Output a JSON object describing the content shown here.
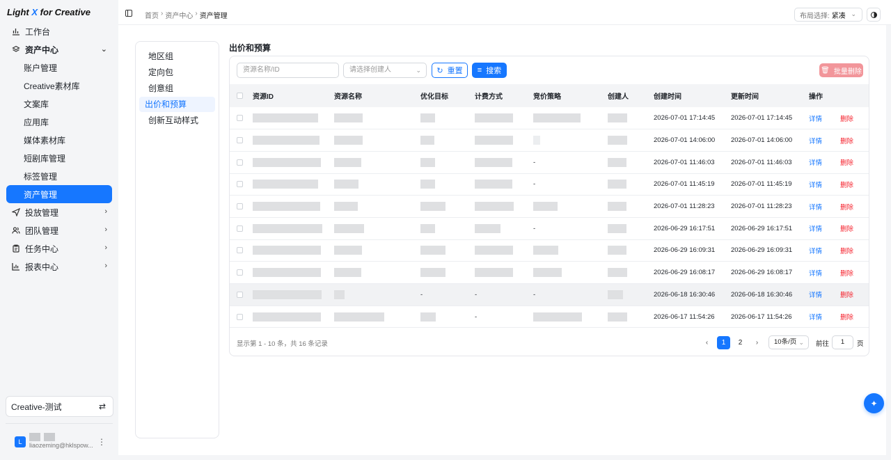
{
  "app": {
    "brand_prefix": "Light ",
    "brand_x": "X",
    "brand_suffix": " for Creative"
  },
  "sidebar": {
    "items": [
      {
        "label": "工作台",
        "icon": "bar-chart-icon"
      },
      {
        "label": "资产中心",
        "icon": "layers-icon",
        "expanded": true,
        "children": [
          "账户管理",
          "Creative素材库",
          "文案库",
          "应用库",
          "媒体素材库",
          "短剧库管理",
          "标签管理",
          "资产管理"
        ]
      },
      {
        "label": "投放管理",
        "icon": "send-icon"
      },
      {
        "label": "团队管理",
        "icon": "team-icon"
      },
      {
        "label": "任务中心",
        "icon": "clipboard-icon"
      },
      {
        "label": "报表中心",
        "icon": "report-icon"
      }
    ],
    "active_child": "资产管理",
    "tenant": "Creative-测试",
    "user": {
      "avatar": "L",
      "email": "liaozeming@hklspow..."
    }
  },
  "topbar": {
    "breadcrumb": [
      "首页",
      "资产中心",
      "资产管理"
    ],
    "layout_label": "布局选择:",
    "layout_value": "紧凑"
  },
  "asset_menu": {
    "items": [
      "地区组",
      "定向包",
      "创意组",
      "出价和预算",
      "创新互动样式"
    ],
    "active": "出价和预算"
  },
  "section_title": "出价和预算",
  "filters": {
    "id_placeholder": "资源名称/ID",
    "creator_placeholder": "请选择创建人",
    "reset": "重置",
    "search": "搜索",
    "batch_delete": "批量删除"
  },
  "table": {
    "columns": [
      "资源ID",
      "资源名称",
      "优化目标",
      "计费方式",
      "竞价策略",
      "创建人",
      "创建时间",
      "更新时间",
      "操作"
    ],
    "action_detail": "详情",
    "action_delete": "删除",
    "rows": [
      {
        "created": "2026-07-01 17:14:45",
        "updated": "2026-07-01 17:14:45",
        "bid": ""
      },
      {
        "created": "2026-07-01 14:06:00",
        "updated": "2026-07-01 14:06:00",
        "bid": ""
      },
      {
        "created": "2026-07-01 11:46:03",
        "updated": "2026-07-01 11:46:03",
        "bid": "-"
      },
      {
        "created": "2026-07-01 11:45:19",
        "updated": "2026-07-01 11:45:19",
        "bid": "-"
      },
      {
        "created": "2026-07-01 11:28:23",
        "updated": "2026-07-01 11:28:23",
        "bid": ""
      },
      {
        "created": "2026-06-29 16:17:51",
        "updated": "2026-06-29 16:17:51",
        "bid": "-"
      },
      {
        "created": "2026-06-29 16:09:31",
        "updated": "2026-06-29 16:09:31",
        "bid": ""
      },
      {
        "created": "2026-06-29 16:08:17",
        "updated": "2026-06-29 16:08:17",
        "bid": ""
      },
      {
        "created": "2026-06-18 16:30:46",
        "updated": "2026-06-18 16:30:46",
        "opt": "-",
        "billing": "-",
        "bid": "-"
      },
      {
        "created": "2026-06-17 11:54:26",
        "updated": "2026-06-17 11:54:26",
        "billing": "-",
        "bid": ""
      }
    ]
  },
  "footer": {
    "summary": "显示第 1 - 10 条，共 16 条记录",
    "pages": [
      "1",
      "2"
    ],
    "current_page": "1",
    "page_size": "10条/页",
    "goto_label": "前往",
    "goto_value": "1",
    "goto_suffix": "页"
  },
  "colors": {
    "primary": "#1677ff",
    "danger": "#f5222d",
    "danger_soft": "#f2959a"
  }
}
